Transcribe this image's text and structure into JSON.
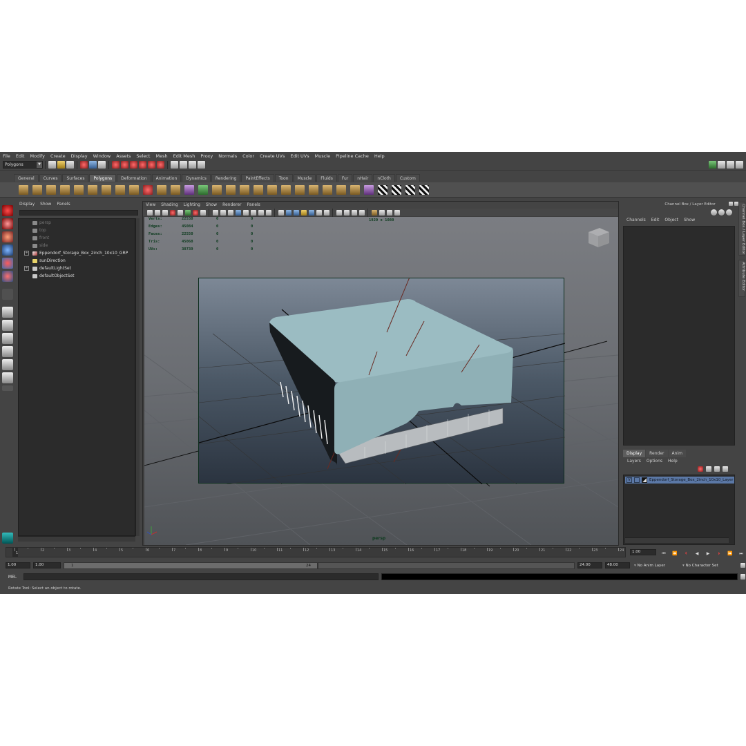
{
  "menubar": [
    "File",
    "Edit",
    "Modify",
    "Create",
    "Display",
    "Window",
    "Assets",
    "Select",
    "Mesh",
    "Edit Mesh",
    "Proxy",
    "Normals",
    "Color",
    "Create UVs",
    "Edit UVs",
    "Muscle",
    "Pipeline Cache",
    "Help"
  ],
  "status_line": {
    "mode": "Polygons"
  },
  "shelf": {
    "tabs": [
      "General",
      "Curves",
      "Surfaces",
      "Polygons",
      "Deformation",
      "Animation",
      "Dynamics",
      "Rendering",
      "PaintEffects",
      "Toon",
      "Muscle",
      "Fluids",
      "Fur",
      "nHair",
      "nCloth",
      "Custom"
    ],
    "active_tab": "Polygons"
  },
  "outliner": {
    "menu": [
      "Display",
      "Show",
      "Panels"
    ],
    "items": [
      {
        "label": "persp",
        "dim": true,
        "expand": false
      },
      {
        "label": "top",
        "dim": true,
        "expand": false
      },
      {
        "label": "front",
        "dim": true,
        "expand": false
      },
      {
        "label": "side",
        "dim": true,
        "expand": false
      },
      {
        "label": "Eppendorf_Storage_Box_2inch_10x10_GRP",
        "dim": false,
        "expand": true
      },
      {
        "label": "sunDirection",
        "dim": false,
        "expand": false
      },
      {
        "label": "defaultLightSet",
        "dim": false,
        "expand": true
      },
      {
        "label": "defaultObjectSet",
        "dim": false,
        "expand": false
      }
    ]
  },
  "viewport": {
    "menu": [
      "View",
      "Shading",
      "Lighting",
      "Show",
      "Renderer",
      "Panels"
    ],
    "stats": {
      "rows": [
        {
          "label": "Verts:",
          "v1": "22538",
          "v2": "0",
          "v3": "0"
        },
        {
          "label": "Edges:",
          "v1": "45084",
          "v2": "0",
          "v3": "0"
        },
        {
          "label": "Faces:",
          "v1": "22550",
          "v2": "0",
          "v3": "0"
        },
        {
          "label": "Tris:",
          "v1": "45068",
          "v2": "0",
          "v3": "0"
        },
        {
          "label": "UVs:",
          "v1": "30739",
          "v2": "0",
          "v3": "0"
        }
      ]
    },
    "resolution": "1920 x 1080",
    "camera": "persp"
  },
  "channel_box": {
    "title": "Channel Box / Layer Editor",
    "menu": [
      "Channels",
      "Edit",
      "Object",
      "Show"
    ]
  },
  "layer_editor": {
    "tabs": [
      "Display",
      "Render",
      "Anim"
    ],
    "active_tab": "Display",
    "menu": [
      "Layers",
      "Options",
      "Help"
    ],
    "layer": {
      "visible": "V",
      "name": "Eppendorf_Storage_Box_2inch_10x10_Layer"
    }
  },
  "side_tabs": [
    "Channel Box / Layer Editor",
    "Attribute Editor"
  ],
  "time_slider": {
    "ticks": [
      "1",
      "2",
      "3",
      "4",
      "5",
      "6",
      "7",
      "8",
      "9",
      "10",
      "11",
      "12",
      "13",
      "14",
      "15",
      "16",
      "17",
      "18",
      "19",
      "20",
      "21",
      "22",
      "23",
      "24"
    ],
    "current_frame": "1",
    "current_time_field": "1.00"
  },
  "range_slider": {
    "start": "1.00",
    "anim_start": "1.00",
    "range_start_label": "1",
    "range_end_label": "24",
    "playback_end": "24.00",
    "anim_end": "48.00",
    "anim_layer": "No Anim Layer",
    "character_set": "No Character Set"
  },
  "command_line": {
    "label": "MEL"
  },
  "help_line": "Rotate Tool: Select an object to rotate.",
  "colors": {
    "ui_bg": "#444444",
    "panel_dark": "#2b2b2b",
    "layer_highlight": "#5b78a6",
    "hud_text": "#0c3a1d",
    "box_lid": "#9ab7bd"
  }
}
